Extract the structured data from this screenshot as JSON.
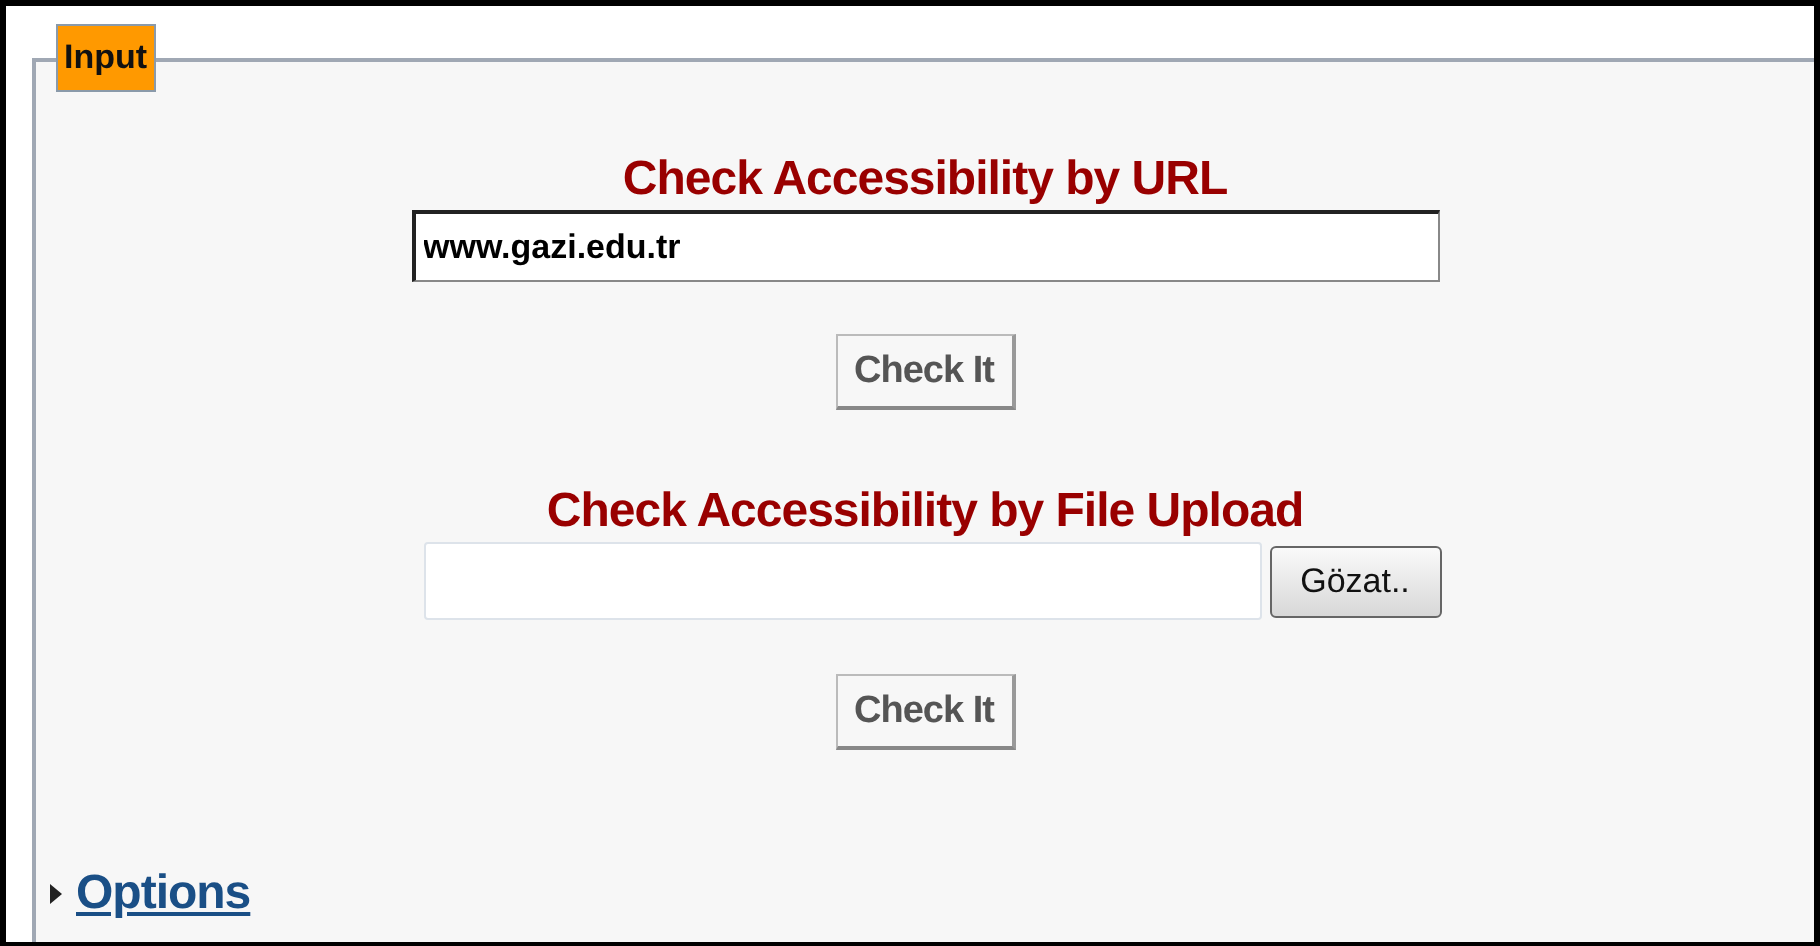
{
  "panel": {
    "legend": "Input"
  },
  "url_section": {
    "heading": "Check Accessibility by URL",
    "url_field": {
      "value": "www.gazi.edu.tr"
    },
    "submit_button": "Check It"
  },
  "upload_section": {
    "heading": "Check Accessibility by File Upload",
    "browse_button": "Gözat..",
    "submit_button": "Check It"
  },
  "options": {
    "label": "Options",
    "expanded": false
  }
}
